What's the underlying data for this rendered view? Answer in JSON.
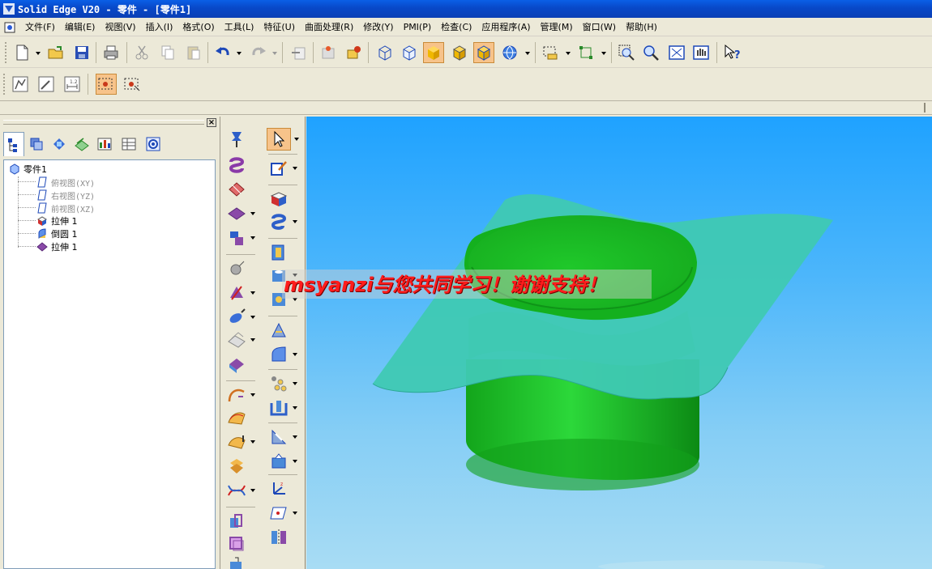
{
  "window": {
    "title": "Solid Edge V20 - 零件 - [零件1]"
  },
  "menu": {
    "items": [
      "文件(F)",
      "编辑(E)",
      "视图(V)",
      "插入(I)",
      "格式(O)",
      "工具(L)",
      "特征(U)",
      "曲面处理(R)",
      "修改(Y)",
      "PMI(P)",
      "检查(C)",
      "应用程序(A)",
      "管理(M)",
      "窗口(W)",
      "帮助(H)"
    ]
  },
  "tree": {
    "root": "零件1",
    "items": [
      {
        "label": "俯视图(XY)",
        "muted": true,
        "icon": "plane-icon"
      },
      {
        "label": "右视图(YZ)",
        "muted": true,
        "icon": "plane-icon"
      },
      {
        "label": "前视图(XZ)",
        "muted": true,
        "icon": "plane-icon"
      },
      {
        "label": "拉伸 1",
        "muted": false,
        "icon": "extrude-icon"
      },
      {
        "label": "倒圆 1",
        "muted": false,
        "icon": "round-icon"
      },
      {
        "label": "拉伸 1",
        "muted": false,
        "icon": "surface-extrude-icon"
      }
    ]
  },
  "viewport": {
    "watermark": "msyanzi与您共同学习！谢谢支持！",
    "colors": {
      "cylinder": "#19c224",
      "surface": "#3fc9b3",
      "background_top": "#1fa2ff",
      "background_bottom": "#a8dcf4"
    }
  }
}
